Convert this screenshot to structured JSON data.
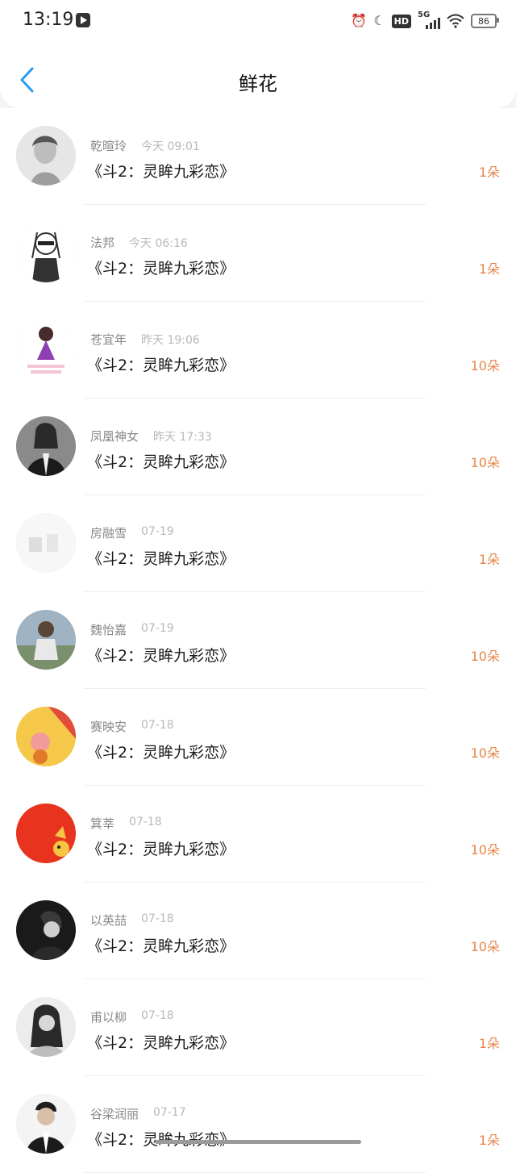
{
  "status": {
    "time": "13:19",
    "battery": "86",
    "network": "5G"
  },
  "nav": {
    "title": "鲜花"
  },
  "items": [
    {
      "name": "乾暄玲",
      "time": "今天 09:01",
      "book": "《斗2：灵眸九彩恋》",
      "count": "1朵",
      "avatar": "avatar-woman-sketch"
    },
    {
      "name": "法邦",
      "time": "今天 06:16",
      "book": "《斗2：灵眸九彩恋》",
      "count": "1朵",
      "avatar": "avatar-cartoon-sunglasses"
    },
    {
      "name": "苍宜年",
      "time": "昨天 19:06",
      "book": "《斗2：灵眸九彩恋》",
      "count": "10朵",
      "avatar": "avatar-doll-purple"
    },
    {
      "name": "凤凰神女",
      "time": "昨天 17:33",
      "book": "《斗2：灵眸九彩恋》",
      "count": "10朵",
      "avatar": "avatar-woman-suit"
    },
    {
      "name": "房融雪",
      "time": "07-19",
      "book": "《斗2：灵眸九彩恋》",
      "count": "1朵",
      "avatar": "avatar-faded-cats"
    },
    {
      "name": "魏怡嘉",
      "time": "07-19",
      "book": "《斗2：灵眸九彩恋》",
      "count": "10朵",
      "avatar": "avatar-man-city"
    },
    {
      "name": "赛映安",
      "time": "07-18",
      "book": "《斗2：灵眸九彩恋》",
      "count": "10朵",
      "avatar": "avatar-cartoon-fox"
    },
    {
      "name": "箕莘",
      "time": "07-18",
      "book": "《斗2：灵眸九彩恋》",
      "count": "10朵",
      "avatar": "avatar-red-mascot"
    },
    {
      "name": "以英喆",
      "time": "07-18",
      "book": "《斗2：灵眸九彩恋》",
      "count": "10朵",
      "avatar": "avatar-man-bw"
    },
    {
      "name": "甫以柳",
      "time": "07-18",
      "book": "《斗2：灵眸九彩恋》",
      "count": "1朵",
      "avatar": "avatar-woman-bw"
    },
    {
      "name": "谷梁润丽",
      "time": "07-17",
      "book": "《斗2：灵眸九彩恋》",
      "count": "1朵",
      "avatar": "avatar-man-portrait"
    }
  ],
  "colors": {
    "accent_blue": "#2d9cf0",
    "count_orange": "#e8864a"
  }
}
